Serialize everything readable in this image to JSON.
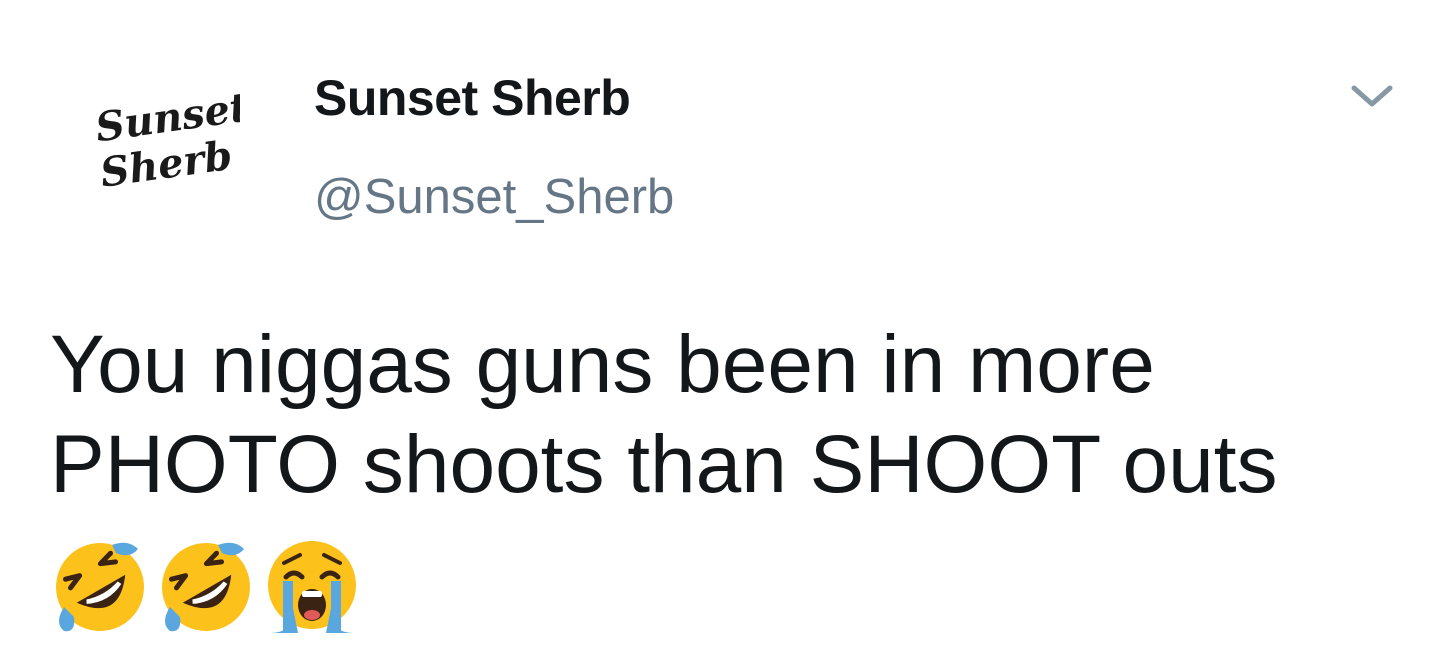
{
  "author": {
    "avatar_text_line1": "Sunset",
    "avatar_text_line2": "Sherb",
    "display_name": "Sunset Sherb",
    "handle": "@Sunset_Sherb"
  },
  "tweet": {
    "text_line1": "You niggas guns been in more",
    "text_line2": "PHOTO shoots than SHOOT outs",
    "emojis": [
      "rolling-on-floor-laughing",
      "rolling-on-floor-laughing",
      "loudly-crying-face"
    ]
  },
  "icons": {
    "menu": "chevron-down-icon"
  },
  "colors": {
    "text": "#14171a",
    "secondary": "#657786",
    "emoji_face": "#fcc21b",
    "emoji_tear": "#5aa7e0"
  }
}
